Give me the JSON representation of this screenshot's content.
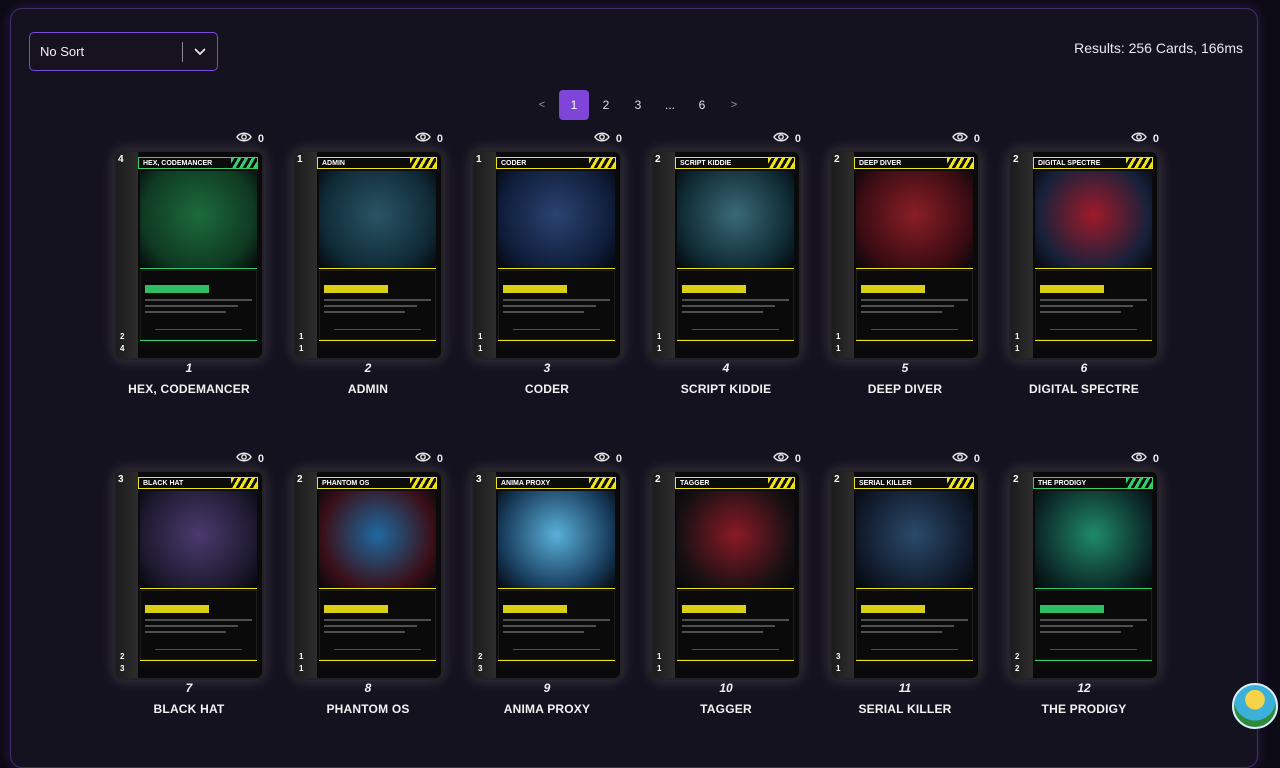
{
  "sort": {
    "label": "No Sort"
  },
  "results": "Results: 256 Cards, 166ms",
  "pagination": {
    "prev": "<",
    "pages": [
      "1",
      "2",
      "3",
      "...",
      "6"
    ],
    "active": "1",
    "next": ">"
  },
  "colors": {
    "accent": "#7e45d8",
    "yellow": "#f1e416",
    "green": "#2fd36a",
    "background": "#15121f"
  },
  "cards": [
    {
      "number": "1",
      "name": "HEX, CODEMANCER",
      "title": "HEX, CODEMANCER",
      "cost": "4",
      "views": "0",
      "accent": "#33d06b",
      "art": [
        "#0f3a22",
        "#1c6b3c"
      ],
      "atk": "2",
      "hp": "4"
    },
    {
      "number": "2",
      "name": "ADMIN",
      "title": "ADMIN",
      "cost": "1",
      "views": "0",
      "accent": "#f1e416",
      "art": [
        "#0f2a36",
        "#2a5466"
      ],
      "atk": "1",
      "hp": "1"
    },
    {
      "number": "3",
      "name": "CODER",
      "title": "CODER",
      "cost": "1",
      "views": "0",
      "accent": "#f1e416",
      "art": [
        "#0f1d3a",
        "#2a4470"
      ],
      "atk": "1",
      "hp": "1"
    },
    {
      "number": "4",
      "name": "SCRIPT KIDDIE",
      "title": "SCRIPT KIDDIE",
      "cost": "2",
      "views": "0",
      "accent": "#f1e416",
      "art": [
        "#0f2a33",
        "#3a6a77"
      ],
      "atk": "1",
      "hp": "1"
    },
    {
      "number": "5",
      "name": "DEEP DIVER",
      "title": "DEEP DIVER",
      "cost": "2",
      "views": "0",
      "accent": "#f1e416",
      "art": [
        "#3a0c12",
        "#8a1e26"
      ],
      "atk": "1",
      "hp": "1"
    },
    {
      "number": "6",
      "name": "DIGITAL SPECTRE",
      "title": "DIGITAL SPECTRE",
      "cost": "2",
      "views": "0",
      "accent": "#f1e416",
      "art": [
        "#17213a",
        "#a01a2a"
      ],
      "atk": "1",
      "hp": "1"
    },
    {
      "number": "7",
      "name": "BLACK HAT",
      "title": "BLACK HAT",
      "cost": "3",
      "views": "0",
      "accent": "#f1e416",
      "art": [
        "#1e1a30",
        "#4b3a6e"
      ],
      "atk": "2",
      "hp": "3"
    },
    {
      "number": "8",
      "name": "PHANTOM OS",
      "title": "PHANTOM OS",
      "cost": "2",
      "views": "0",
      "accent": "#f1e416",
      "art": [
        "#3a0f18",
        "#1e6aa0"
      ],
      "atk": "1",
      "hp": "1"
    },
    {
      "number": "9",
      "name": "ANIMA PROXY",
      "title": "ANIMA PROXY",
      "cost": "3",
      "views": "0",
      "accent": "#f1e416",
      "art": [
        "#173a5a",
        "#5ab0d8"
      ],
      "atk": "2",
      "hp": "3"
    },
    {
      "number": "10",
      "name": "TAGGER",
      "title": "TAGGER",
      "cost": "2",
      "views": "0",
      "accent": "#f1e416",
      "art": [
        "#1a1012",
        "#8a1a26"
      ],
      "atk": "1",
      "hp": "1"
    },
    {
      "number": "11",
      "name": "SERIAL KILLER",
      "title": "SERIAL KILLER",
      "cost": "2",
      "views": "0",
      "accent": "#f1e416",
      "art": [
        "#101a2a",
        "#2a4a6a"
      ],
      "atk": "3",
      "hp": "1"
    },
    {
      "number": "12",
      "name": "THE PRODIGY",
      "title": "THE PRODIGY",
      "cost": "2",
      "views": "0",
      "accent": "#2fd36a",
      "art": [
        "#0c2a28",
        "#1f8a6a"
      ],
      "atk": "2",
      "hp": "2"
    }
  ]
}
